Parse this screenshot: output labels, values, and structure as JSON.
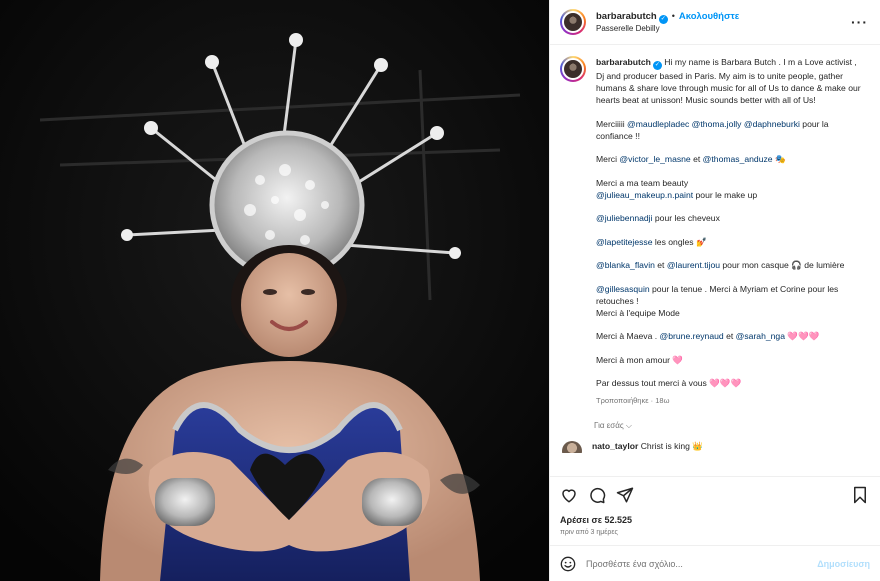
{
  "post": {
    "username": "barbarabutch",
    "follow_label": "Ακολουθήστε",
    "location": "Passerelle Debilly",
    "more_icon": "more-horizontal-icon"
  },
  "caption": {
    "username": "barbarabutch",
    "intro": " Hi my name is Barbara Butch . I m a Love activist , Dj and producer based in Paris. My aim is to unite people, gather humans & share love through music for all of Us to dance & make our hearts beat at unisson! Music sounds better with all of Us!",
    "thanks_1": "Merciiiii",
    "mention_1": "@maudlepladec",
    "mention_2": "@thoma.jolly",
    "mention_3": "@daphneburki",
    "thanks_1_end": " pour la confiance !!",
    "thanks_2": "Merci ",
    "mention_4": "@victor_le_masne",
    "thanks_2_mid": " et ",
    "mention_5": "@thomas_anduze",
    "thanks_2_emoji": " 🎭",
    "beauty": "Merci a ma team beauty",
    "mention_6": "@julieau_makeup.n.paint",
    "beauty_end": " pour le make up",
    "mention_7": "@juliebennadji",
    "hair": " pour les cheveux",
    "mention_8": "@lapetitejesse",
    "nails": " les ongles 💅",
    "mention_9": "@blanka_flavin",
    "helmet_mid": " et ",
    "mention_10": "@laurent.tijou",
    "helmet_end": " pour mon casque 🎧 de lumière",
    "mention_11": "@gillesasquin",
    "outfit": " pour la tenue . Merci à Myriam et Corine pour les retouches !",
    "mode": "Merci à l'equipe Mode",
    "maeva": "Merci à Maeva . ",
    "mention_12": "@brune.reynaud",
    "maeva_mid": " et ",
    "mention_13": "@sarah_nga",
    "maeva_end": " 🩷🩷🩷",
    "love": "Merci à mon amour 🩷",
    "final": "Par dessus tout merci à vous 🩷🩷🩷",
    "edited": "Τροποποιήθηκε · 18ω"
  },
  "translate_label": "Για εσάς",
  "comment2": {
    "username": "nato_taylor",
    "text": " Christ is king 👑"
  },
  "actions": {
    "like_icon": "heart-icon",
    "comment_icon": "comment-icon",
    "share_icon": "send-icon",
    "save_icon": "bookmark-icon",
    "likes_text": "Αρέσει σε 52.525",
    "ago_text": "πριν από 3 ημέρες"
  },
  "add_comment": {
    "placeholder": "Προσθέστε ένα σχόλιο...",
    "post_label": "Δημοσίευση",
    "post_color": "#b2dffc"
  },
  "colors": {
    "accent": "#0095f6",
    "mention": "#00376b"
  }
}
